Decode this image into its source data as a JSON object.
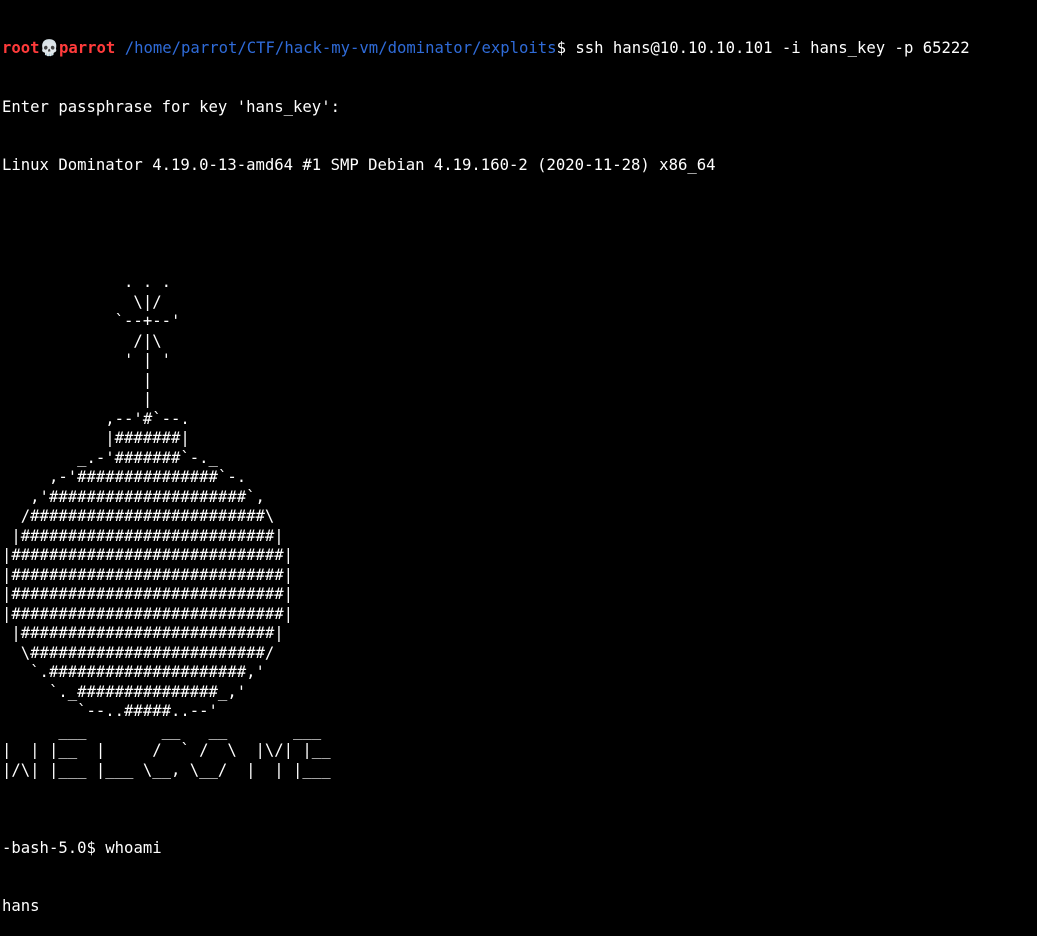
{
  "prompt": {
    "user": "root",
    "skull_icon": "💀",
    "host": "parrot",
    "path": " /home/parrot/CTF/hack-my-vm/dominator/exploits",
    "symbol": "$ ",
    "command": "ssh hans@10.10.10.101 -i hans_key -p 65222"
  },
  "output": {
    "passphrase_prompt": "Enter passphrase for key 'hans_key':",
    "system_info": "Linux Dominator 4.19.0-13-amd64 #1 SMP Debian 4.19.160-2 (2020-11-28) x86_64",
    "blank": ""
  },
  "banner_lines": [
    "             . . .",
    "              \\|/",
    "            `--+--'",
    "              /|\\",
    "             ' | '",
    "               |",
    "               |",
    "           ,--'#`--.",
    "           |#######|",
    "        _.-'#######`-._",
    "     ,-'###############`-.",
    "   ,'#####################`,",
    "  /#########################\\",
    " |###########################|",
    "|#############################|",
    "|#############################|",
    "|#############################|",
    "|#############################|",
    " |###########################|",
    "  \\#########################/",
    "   `.#####################,'",
    "     `._###############_,'",
    "        `--..#####..--'",
    "      ___        __   __       ___",
    "|  | |__  |     /  ` /  \\  |\\/| |__",
    "|/\\| |___ |___ \\__, \\__/  |  | |___",
    ""
  ],
  "session": {
    "shell_prompt": "-bash-5.0$ ",
    "command": "whoami",
    "result": "hans"
  }
}
